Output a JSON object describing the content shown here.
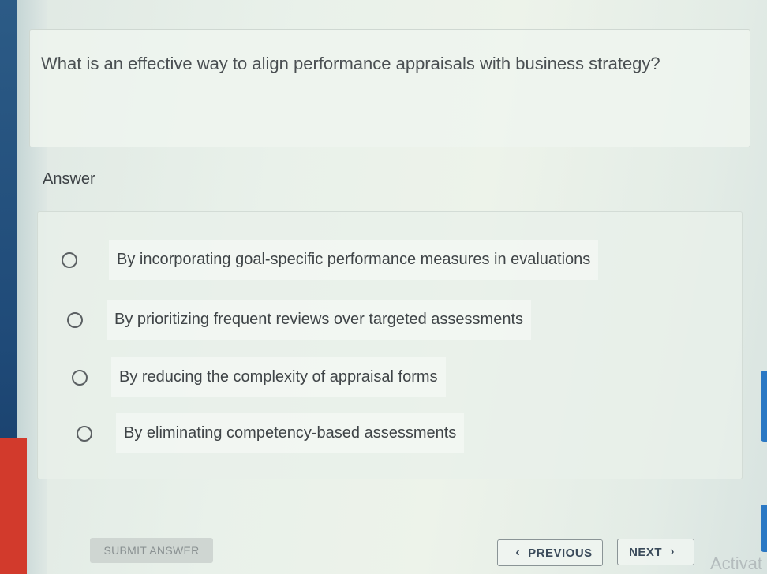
{
  "question": {
    "text": "What is an effective way to align performance appraisals with business strategy?"
  },
  "answer_heading": "Answer",
  "options": [
    {
      "label": "By incorporating goal-specific performance measures in evaluations",
      "selected": false
    },
    {
      "label": "By prioritizing frequent reviews over targeted assessments",
      "selected": false
    },
    {
      "label": "By reducing the complexity of appraisal forms",
      "selected": false
    },
    {
      "label": "By eliminating competency-based assessments",
      "selected": false
    }
  ],
  "buttons": {
    "submit": "SUBMIT ANSWER",
    "previous": "PREVIOUS",
    "next": "NEXT"
  },
  "icons": {
    "previous": "chevron-left-icon",
    "next": "chevron-right-icon"
  },
  "watermark": "Activat",
  "colors": {
    "radio_border": "#5b6063",
    "nav_text": "#3a4a5a",
    "submit_disabled_bg": "#cfd6d2"
  }
}
